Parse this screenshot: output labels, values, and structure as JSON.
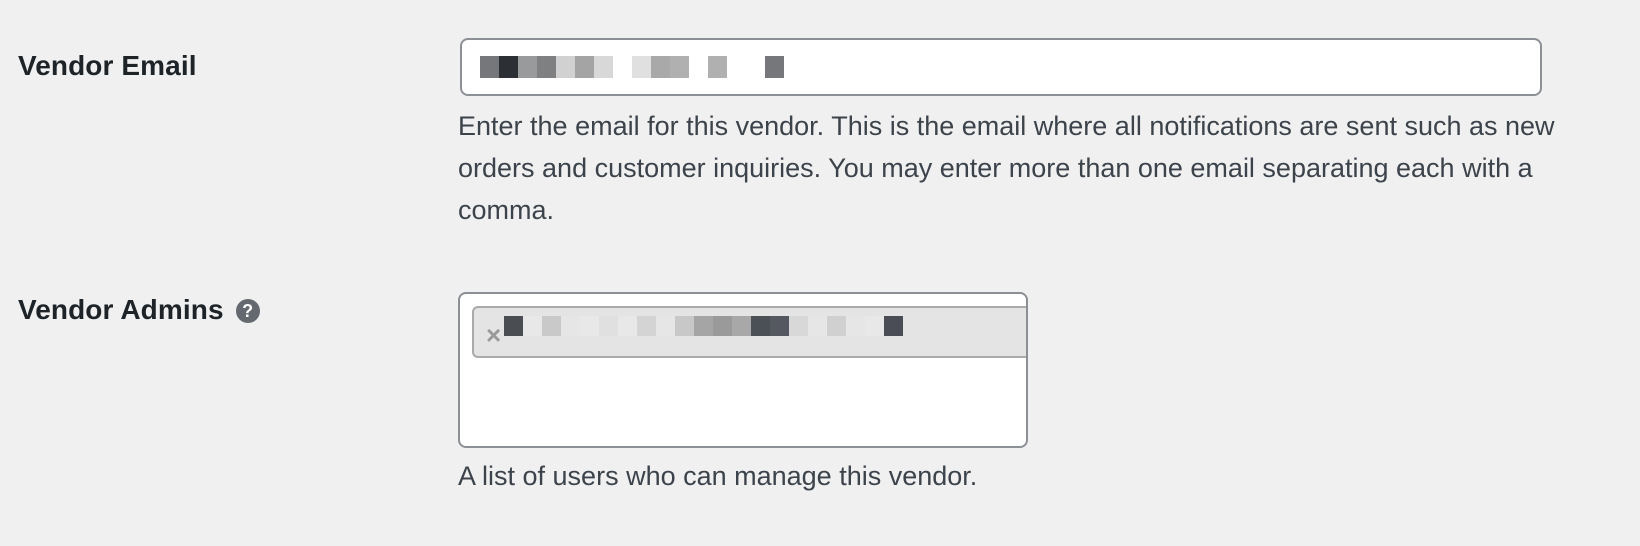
{
  "vendor_email": {
    "label": "Vendor Email",
    "description": "Enter the email for this vendor. This is the email where all notifications are sent such as new orders and customer inquiries. You may enter more than one email separating each with a comma.",
    "value_pixels": [
      "#76777b",
      "#2c2f33",
      "#999a9c",
      "#7f8082",
      "#d1d1d2",
      "#a4a4a5",
      "#d8d8d8",
      "#ffffff",
      "#e0e0e0",
      "#a9a9a9",
      "#b0b0b0",
      "#ffffff",
      "#b0b0b1",
      "#ffffff",
      "#ffffff",
      "#76777b"
    ]
  },
  "vendor_admins": {
    "label": "Vendor Admins",
    "help_icon": "question-circle-icon",
    "help_glyph": "?",
    "remove_glyph": "×",
    "description": "A list of users who can manage this vendor.",
    "choice_pixels": [
      "#4a4d52",
      "#e8e8e8",
      "#c9c9c9",
      "#e6e6e6",
      "#e8e8e8",
      "#e0e0e0",
      "#e8e8e8",
      "#d4d4d4",
      "#e6e6e6",
      "#c8c8c8",
      "#a5a5a5",
      "#9a9a9a",
      "#a8a8a8",
      "#4b4f56",
      "#555860",
      "#d8d8d8",
      "#e6e6e6",
      "#d0d0d0",
      "#e6e6e6",
      "#e8e8e8",
      "#4a4d55",
      "#e4e4e4"
    ]
  },
  "colors": {
    "background": "#f0f0f1",
    "input_border": "#8c8f94",
    "label_text": "#1d2327",
    "description_text": "#3c434a",
    "help_icon_bg": "#646970",
    "choice_bg": "#e4e4e4"
  }
}
